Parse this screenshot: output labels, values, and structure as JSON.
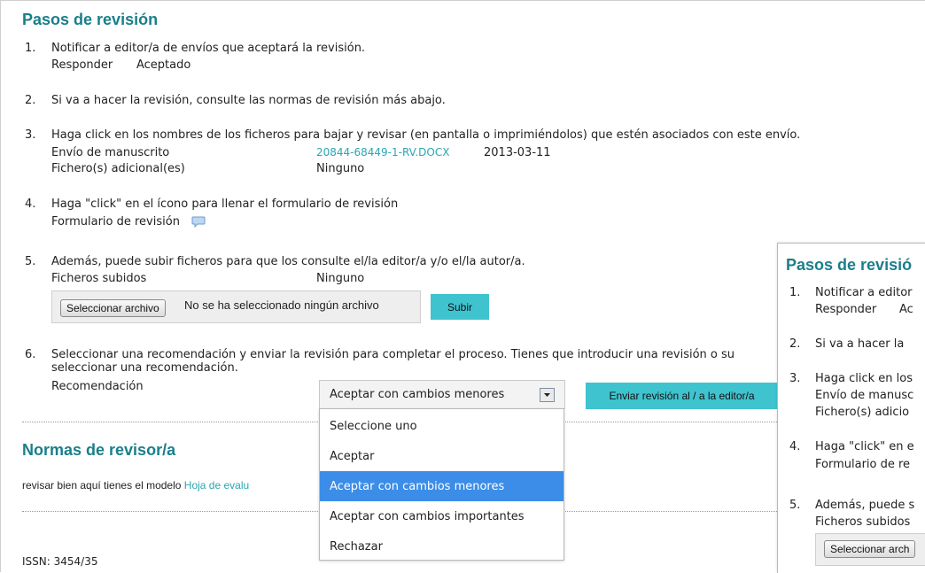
{
  "review": {
    "title": "Pasos de revisión",
    "steps": [
      {
        "num": "1.",
        "text": "Notificar a editor/a de envíos que aceptará la revisión.",
        "sub": {
          "respond": "Responder",
          "accepted": "Aceptado"
        }
      },
      {
        "num": "2.",
        "text": "Si va a hacer la revisión, consulte las normas de revisión más abajo."
      },
      {
        "num": "3.",
        "text": "Haga click en los nombres de los ficheros para bajar y revisar (en pantalla o imprimiéndolos) que estén asociados con este envío.",
        "manuscript_label": "Envío de manuscrito",
        "manuscript_file": "20844-68449-1-RV.DOCX",
        "manuscript_date": "2013-03-11",
        "additional_label": "Fichero(s) adicional(es)",
        "additional_value": "Ninguno"
      },
      {
        "num": "4.",
        "text": "Haga \"click\" en el ícono para llenar el formulario de revisión",
        "form_label": "Formulario de revisión"
      },
      {
        "num": "5.",
        "text": "Además, puede subir ficheros para que los consulte el/la editor/a y/o el/la autor/a.",
        "uploaded_label": "Ficheros subidos",
        "uploaded_value": "Ninguno",
        "choose_file": "Seleccionar archivo",
        "no_file": "No se ha seleccionado ningún archivo",
        "upload": "Subir"
      },
      {
        "num": "6.",
        "text_line1": "Seleccionar una recomendación y enviar la revisión para completar el proceso. Tienes que introducir una revisión o su",
        "text_line2": "seleccionar una recomendación.",
        "recommendation_label": "Recomendación",
        "selected": "Aceptar con cambios menores",
        "send": "Enviar revisión al / a la editor/a"
      }
    ]
  },
  "dropdown": {
    "options": [
      "Seleccione uno",
      "Aceptar",
      "Aceptar con cambios menores",
      "Aceptar con cambios importantes",
      "Rechazar"
    ],
    "selected_index": 2
  },
  "norms": {
    "title": "Normas de revisor/a",
    "text": "revisar bien aquí tienes el modelo ",
    "link": "Hoja de evalu"
  },
  "footer": {
    "issn": "ISSN: 3454/35"
  },
  "overlay": {
    "title": "Pasos de revisió",
    "l1a": "Notificar a editor",
    "l1b_a": "Responder",
    "l1b_b": "Ac",
    "l2": "Si va a hacer la",
    "l3": "Haga click en los",
    "l3b": "Envío de manusc",
    "l3c": "Fichero(s) adicio",
    "l4": "Haga \"click\" en e",
    "l4b": "Formulario de re",
    "l5": "Además, puede s",
    "l5b": "Ficheros subidos",
    "l5c": "Seleccionar arch",
    "n1": "1.",
    "n2": "2.",
    "n3": "3.",
    "n4": "4.",
    "n5": "5."
  },
  "colors": {
    "accent": "#1a7f8a",
    "link": "#2aa6b2",
    "button": "#3fc3cf",
    "selected_option": "#3b8de8"
  }
}
